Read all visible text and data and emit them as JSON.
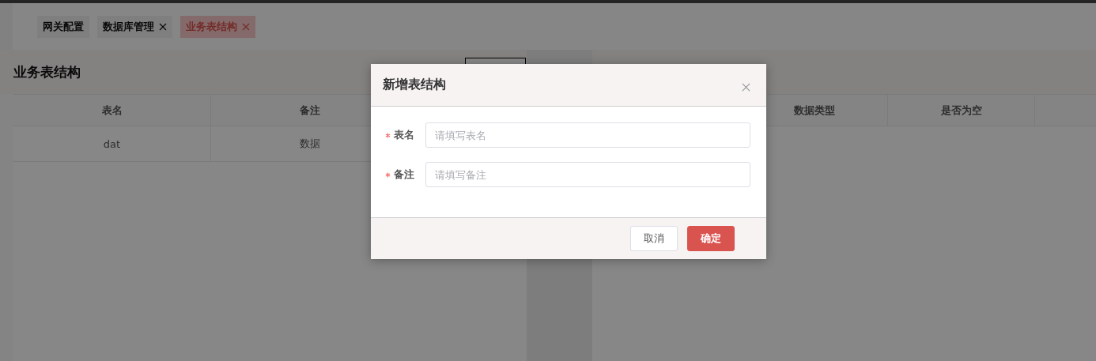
{
  "tabs": [
    {
      "label": "网关配置",
      "closable": false,
      "selected": false
    },
    {
      "label": "数据库管理",
      "closable": true,
      "selected": false
    },
    {
      "label": "业务表结构",
      "closable": true,
      "selected": true
    }
  ],
  "page_title": "业务表结构",
  "left_table": {
    "columns": [
      "表名",
      "备注"
    ],
    "rows": [
      [
        "dat",
        "数据"
      ]
    ]
  },
  "right_table": {
    "columns": [
      "数据类型",
      "是否为空"
    ]
  },
  "dialog": {
    "title": "新增表结构",
    "fields": [
      {
        "label": "表名",
        "required": true,
        "placeholder": "请填写表名"
      },
      {
        "label": "备注",
        "required": true,
        "placeholder": "请填写备注"
      }
    ],
    "buttons": [
      {
        "label": "取消",
        "kind": "secondary"
      },
      {
        "label": "确定",
        "kind": "primary"
      }
    ]
  }
}
